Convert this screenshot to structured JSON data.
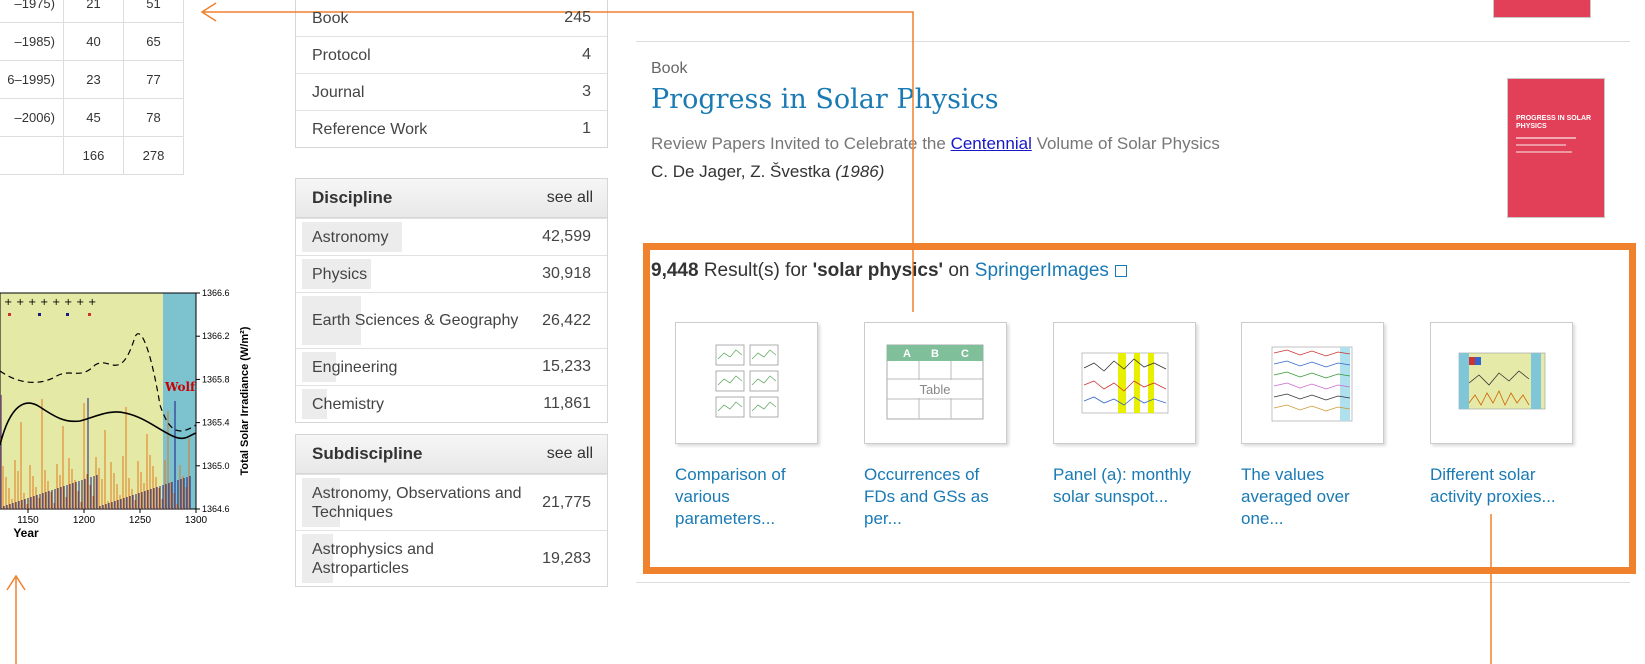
{
  "left_table": {
    "rows": [
      [
        "–1975)",
        "21",
        "51"
      ],
      [
        "–1985)",
        "40",
        "65"
      ],
      [
        "6–1995)",
        "23",
        "77"
      ],
      [
        "–2006)",
        "45",
        "78"
      ],
      [
        "",
        "166",
        "278"
      ]
    ]
  },
  "chart": {
    "xlabel": "Year",
    "ylabel": "Total Solar Irradiance (W/m²)",
    "x_ticks": [
      "1150",
      "1200",
      "1250",
      "1300"
    ],
    "y_ticks": [
      "1366.6",
      "1366.2",
      "1365.8",
      "1365.4",
      "1365.0",
      "1364.6"
    ],
    "label_wolf": "Wolf"
  },
  "content_type": {
    "items": [
      {
        "label": "Book",
        "count": "245"
      },
      {
        "label": "Protocol",
        "count": "4"
      },
      {
        "label": "Journal",
        "count": "3"
      },
      {
        "label": "Reference Work",
        "count": "1"
      }
    ]
  },
  "discipline": {
    "title": "Discipline",
    "see_all": "see all",
    "items": [
      {
        "label": "Astronomy",
        "count": "42,599",
        "share": 0.32
      },
      {
        "label": "Physics",
        "count": "30,918",
        "share": 0.22
      },
      {
        "label": "Earth Sciences & Geography",
        "count": "26,422",
        "share": 0.19
      },
      {
        "label": "Engineering",
        "count": "15,233",
        "share": 0.11
      },
      {
        "label": "Chemistry",
        "count": "11,861",
        "share": 0.08
      }
    ]
  },
  "subdiscipline": {
    "title": "Subdiscipline",
    "see_all": "see all",
    "items": [
      {
        "label": "Astronomy, Observations and Techniques",
        "count": "21,775",
        "share": 0.12
      },
      {
        "label": "Astrophysics and Astroparticles",
        "count": "19,283",
        "share": 0.1
      }
    ]
  },
  "result": {
    "doc_type": "Book",
    "title": "Progress in Solar Physics",
    "subtitle_before": "Review Papers Invited to Celebrate the ",
    "subtitle_highlight": "Centennial",
    "subtitle_after": " Volume of Solar Physics",
    "authors": "C. De Jager, Z. Švestka",
    "year": "(1986)",
    "cover_text": "PROGRESS IN SOLAR PHYSICS"
  },
  "springer_images": {
    "count": "9,448",
    "text_mid": " Result(s) for ",
    "query": "'solar physics'",
    "text_on": " on ",
    "source": "SpringerImages",
    "table_placeholder": "Table",
    "table_cols": [
      "A",
      "B",
      "C"
    ],
    "items": [
      {
        "caption": "Comparison of various parameters..."
      },
      {
        "caption": "Occurrences of FDs and GSs as per..."
      },
      {
        "caption": "Panel (a): monthly solar sunspot..."
      },
      {
        "caption": "The values averaged over one..."
      },
      {
        "caption": "Different solar activity proxies..."
      }
    ]
  },
  "colors": {
    "accent": "#f0812d",
    "link": "#1a7ab4",
    "cover": "#e24059"
  }
}
